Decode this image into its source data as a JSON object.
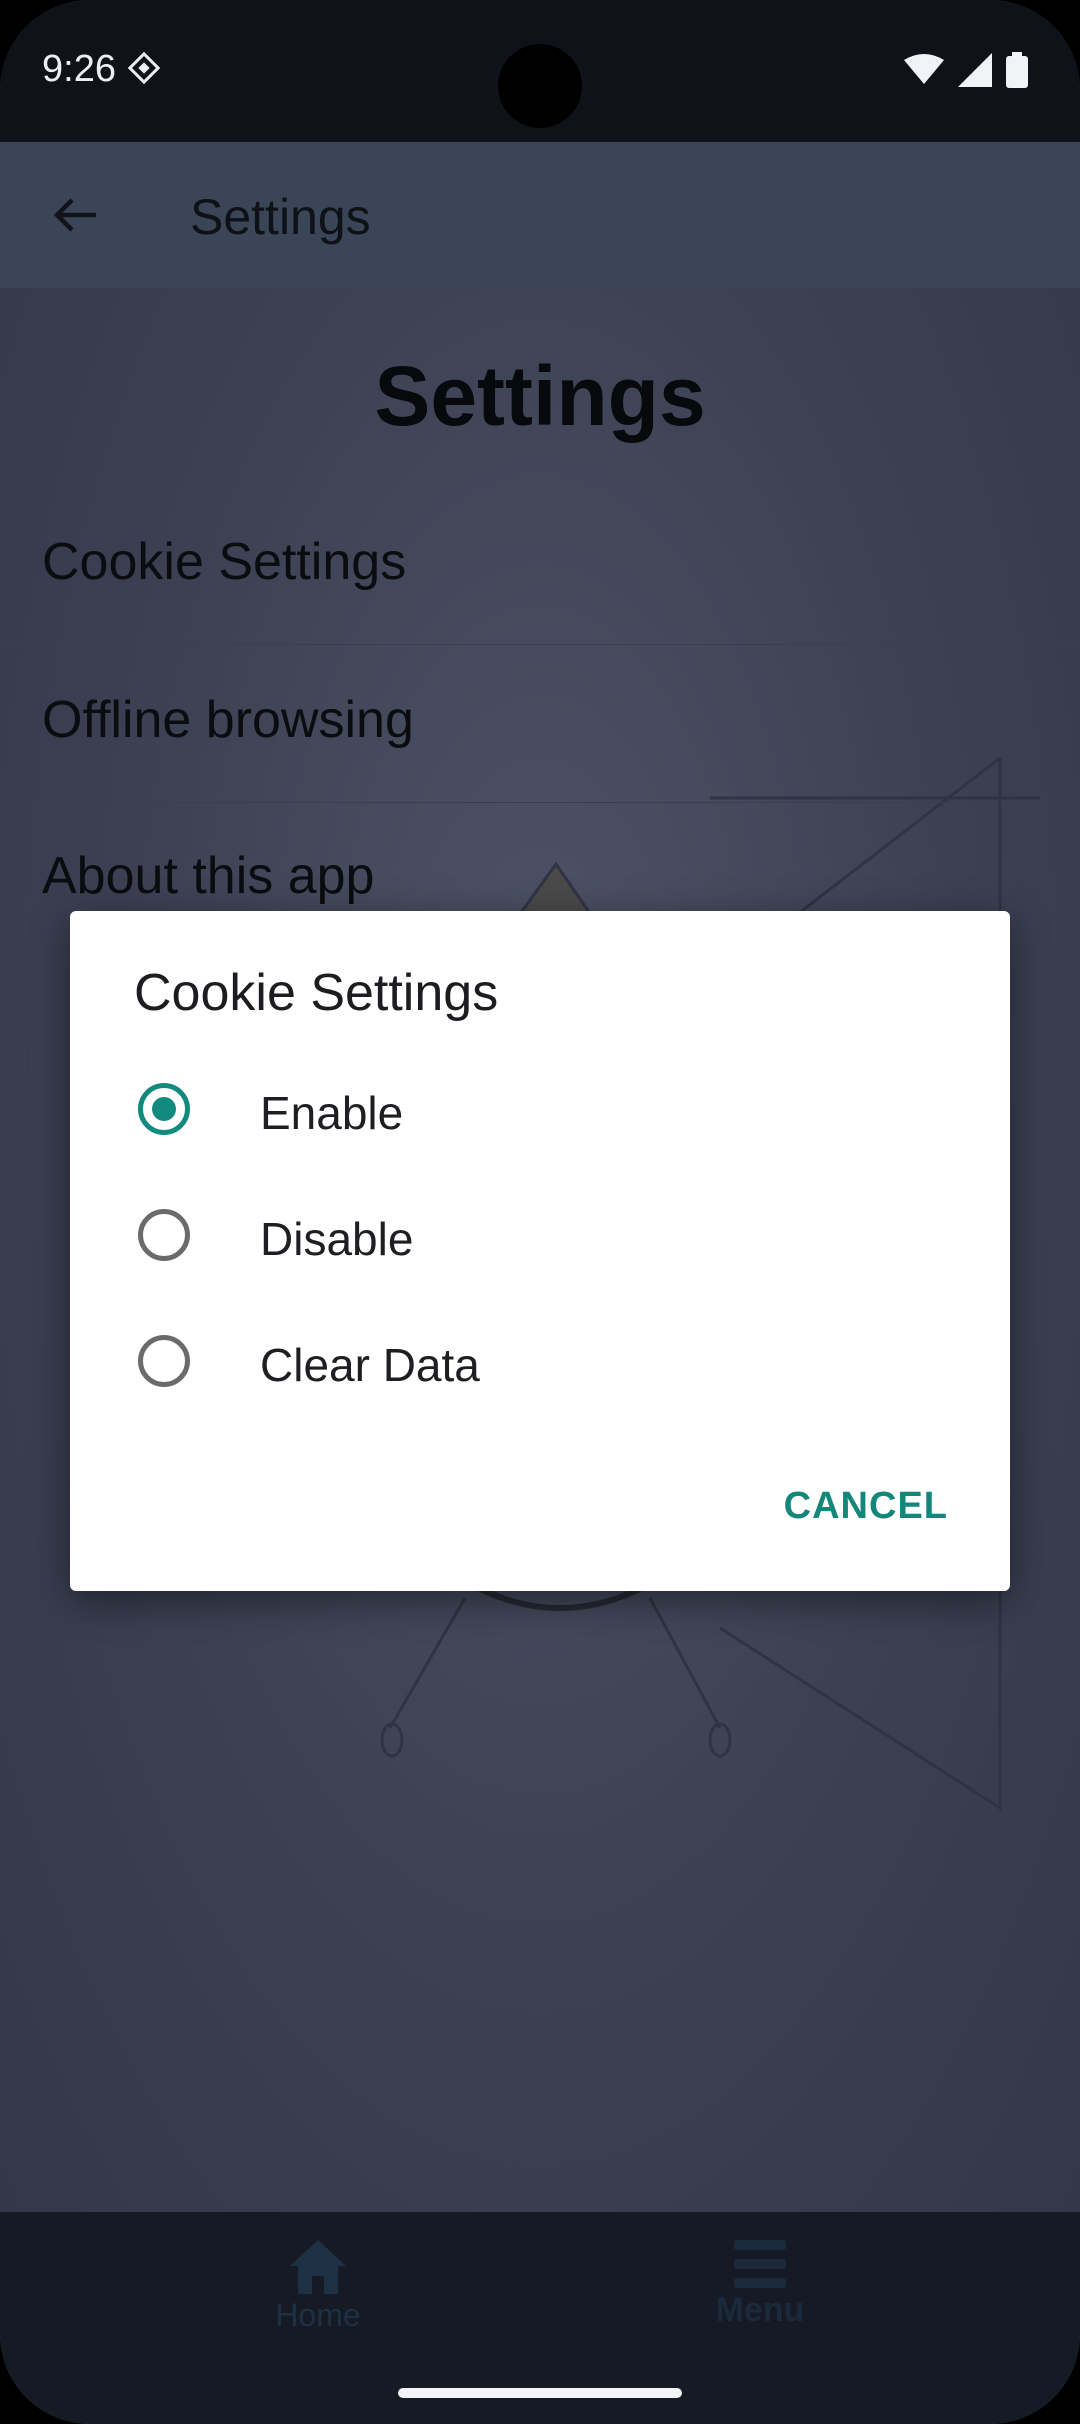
{
  "status_bar": {
    "time": "9:26"
  },
  "app_bar": {
    "title": "Settings"
  },
  "page": {
    "heading": "Settings",
    "menu_items": [
      "Cookie Settings",
      "Offline browsing",
      "About this app"
    ]
  },
  "dialog": {
    "title": "Cookie Settings",
    "options": [
      {
        "label": "Enable",
        "selected": true
      },
      {
        "label": "Disable",
        "selected": false
      },
      {
        "label": "Clear Data",
        "selected": false
      }
    ],
    "cancel_label": "CANCEL",
    "accent_color": "#138a7e"
  },
  "bottom_nav": {
    "items": [
      {
        "label": "Home",
        "icon": "home-icon"
      },
      {
        "label": "Menu",
        "icon": "menu-icon"
      }
    ]
  }
}
